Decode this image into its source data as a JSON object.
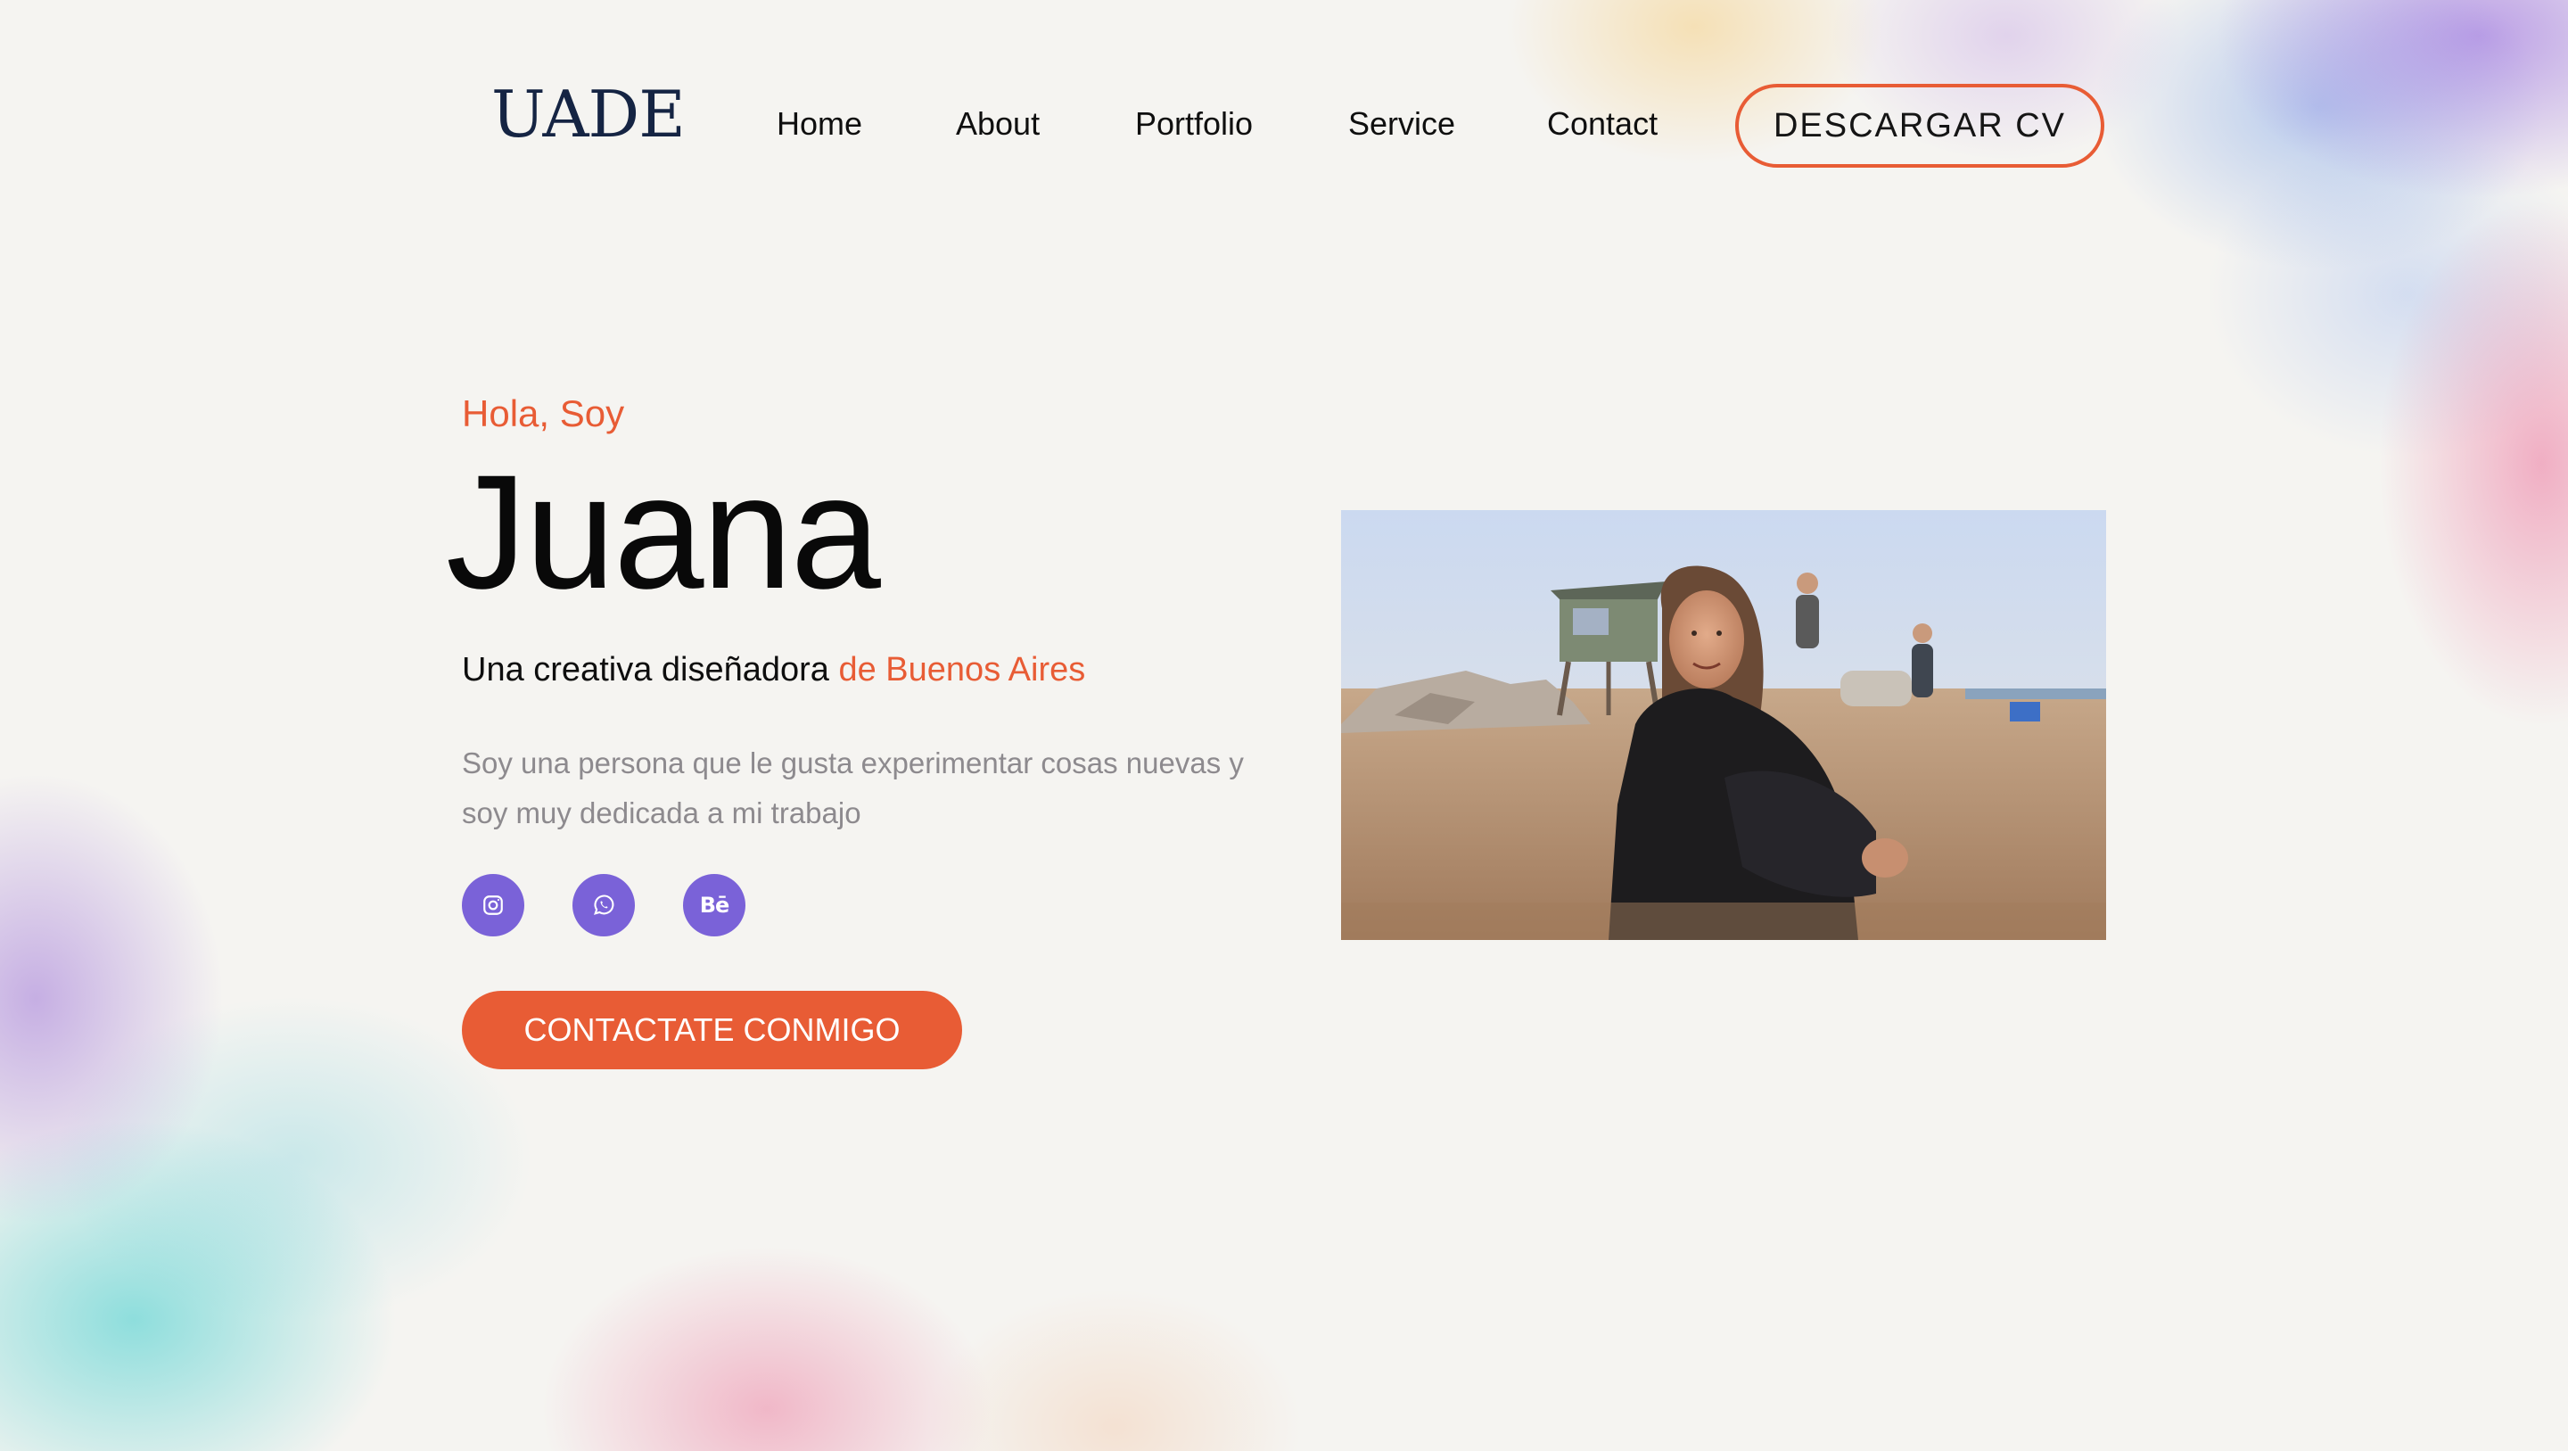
{
  "brand": {
    "logo_text": "UADE"
  },
  "nav": {
    "items": [
      {
        "label": "Home"
      },
      {
        "label": "About"
      },
      {
        "label": "Portfolio"
      },
      {
        "label": "Service"
      },
      {
        "label": "Contact"
      }
    ],
    "cta_label": "DESCARGAR CV"
  },
  "hero": {
    "greeting": "Hola, Soy",
    "name": "Juana",
    "tagline_prefix": "Una creativa diseñadora",
    "tagline_highlight": "de Buenos Aires",
    "description": "Soy una persona que le gusta experimentar cosas nuevas y soy muy dedicada a mi trabajo",
    "social_links": [
      {
        "icon": "instagram-icon"
      },
      {
        "icon": "whatsapp-icon"
      },
      {
        "icon": "behance-icon",
        "label": "Bē"
      }
    ],
    "contact_button_label": "CONTACTATE CONMIGO",
    "photo_subject": "beach-portrait-photo"
  },
  "colors": {
    "accent": "#e85c35",
    "social": "#7a62d8",
    "text": "#0b0b0b",
    "muted": "#8d8a8e",
    "logo": "#152443"
  }
}
